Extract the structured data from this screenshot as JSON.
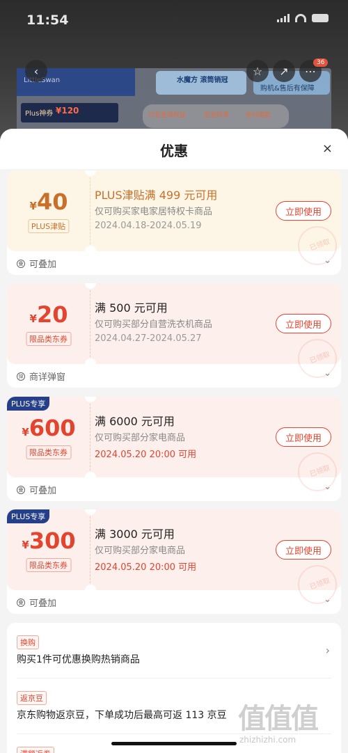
{
  "status": {
    "time": "11:54"
  },
  "background": {
    "banner_brand": "LittleSwan",
    "banner_mid": "水魔方 滚筒销冠",
    "banner_right": "购机&售后有保障",
    "plus_label": "Plus神券",
    "plus_amount": "¥120",
    "timeline_a": "付定金锁权益",
    "timeline_b": "定金结束",
    "timeline_c": "抢付尾款",
    "cart_badge": "36"
  },
  "sheet": {
    "title": "优惠",
    "close": "×"
  },
  "coupons": [
    {
      "currency": "¥",
      "amount": "40",
      "tag": "PLUS津贴",
      "title": "PLUS津贴满 499 元可用",
      "desc": "仅可购买家电家居特权卡商品",
      "date": "2024.04.18-2024.05.19",
      "button": "立即使用",
      "footer": "可叠加",
      "footer_icon": "叠",
      "stamp": "已领取"
    },
    {
      "currency": "¥",
      "amount": "20",
      "tag": "限品类东券",
      "title": "满 500 元可用",
      "desc": "仅可购买部分自营洗衣机商品",
      "date": "2024.04.27-2024.05.27",
      "button": "立即使用",
      "footer": "商详弹窗",
      "footer_icon": "弹",
      "stamp": "已领取"
    },
    {
      "badge": "PLUS专享",
      "currency": "¥",
      "amount": "600",
      "tag": "限品类东券",
      "title": "满 6000 元可用",
      "desc": "仅可购买部分家电商品",
      "date": "2024.05.20 20:00 可用",
      "button": "立即使用",
      "footer": "可叠加",
      "footer_icon": "叠",
      "stamp": "已领取"
    },
    {
      "badge": "PLUS专享",
      "currency": "¥",
      "amount": "300",
      "tag": "限品类东券",
      "title": "满 3000 元可用",
      "desc": "仅可购买部分家电商品",
      "date": "2024.05.20 20:00 可用",
      "button": "立即使用",
      "footer": "可叠加",
      "footer_icon": "叠",
      "stamp": "已领取"
    }
  ],
  "info": [
    {
      "tag": "换购",
      "text": "购买1件可优惠换购热销商品"
    },
    {
      "tag": "返京豆",
      "text": "京东购物返京豆，下单成功后最高可返 113 京豆"
    },
    {
      "tag": "满额返券",
      "text": ""
    }
  ],
  "watermark": {
    "logo": "值值值",
    "url": "zhizhizhi.com"
  }
}
